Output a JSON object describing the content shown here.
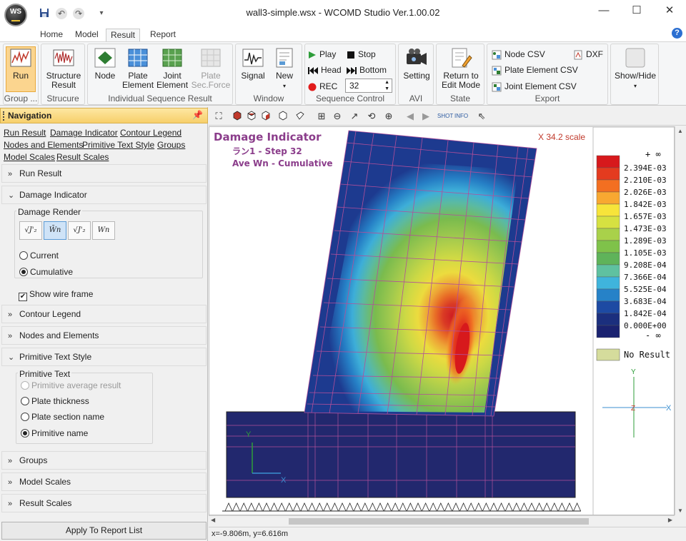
{
  "app": {
    "logo_text": "WS",
    "window_title": "wall3-simple.wsx - WCOMD Studio Ver.1.00.02",
    "tabs": [
      "Home",
      "Model",
      "Result",
      "Report"
    ],
    "active_tab": "Result"
  },
  "ribbon": {
    "group_label": "Group ...",
    "run_label": "Run",
    "structure_label": "Structure Result",
    "structure_group": "Strucure",
    "node_label": "Node",
    "plate_element_label": "Plate Element",
    "joint_element_label": "Joint Element",
    "plate_force_label": "Plate Sec.Force",
    "isr_group": "Individual Sequence Result",
    "signal_label": "Signal",
    "new_label": "New",
    "window_group": "Window",
    "play_label": "Play",
    "stop_label": "Stop",
    "head_label": "Head",
    "bottom_label": "Bottom",
    "rec_label": "REC",
    "step_value": "32",
    "sequence_group": "Sequence Control",
    "setting_label": "Setting",
    "avi_group": "AVI",
    "return_label": "Return to Edit Mode",
    "state_group": "State",
    "node_csv": "Node CSV",
    "dxf": "DXF",
    "plate_csv": "Plate Element CSV",
    "joint_csv": "Joint Element CSV",
    "export_group": "Export",
    "showhide_label": "Show/Hide"
  },
  "navigation": {
    "title": "Navigation",
    "links": [
      "Run Result",
      "Damage Indicator",
      "Contour Legend",
      "Nodes and Elements",
      "Primitive Text Style",
      "Groups",
      "Model Scales",
      "Result Scales"
    ],
    "sections": {
      "run_result": "Run Result",
      "damage_indicator": "Damage Indicator",
      "contour_legend": "Contour Legend",
      "nodes_elements": "Nodes and Elements",
      "primitive_text_style": "Primitive Text Style",
      "groups": "Groups",
      "model_scales": "Model Scales",
      "result_scales": "Result Scales"
    },
    "damage_render": {
      "title": "Damage Render",
      "buttons": [
        "√J'₂",
        "W̄n",
        "√J'₂",
        "Wn"
      ],
      "active_index": 1,
      "options": [
        "Current",
        "Cumulative"
      ],
      "selected": "Cumulative"
    },
    "show_wire_frame": "Show wire frame",
    "primitive_text": {
      "title": "Primitive Text",
      "options": [
        "Primitive average result",
        "Plate thickness",
        "Plate section name",
        "Primitive name"
      ],
      "selected": "Primitive name",
      "disabled": "Primitive average result"
    },
    "apply_button": "Apply To Report List"
  },
  "viewer": {
    "title": "Damage Indicator",
    "step_line": "ラン1 - Step 32",
    "mode_line": "Ave Wn - Cumulative",
    "scale_text": "X 34.2 scale",
    "axis_x": "X",
    "axis_y": "Y",
    "axis_z": "Z",
    "status": "x=-9.806m, y=6.616m",
    "legend": {
      "top": "+ ∞",
      "bottom": "- ∞",
      "no_result": "No Result",
      "entries": [
        {
          "label": "2.394E-03",
          "color": "#d7191c"
        },
        {
          "label": "2.210E-03",
          "color": "#e43b1f"
        },
        {
          "label": "2.026E-03",
          "color": "#f36f21"
        },
        {
          "label": "1.842E-03",
          "color": "#f8a831"
        },
        {
          "label": "1.657E-03",
          "color": "#f7e43a"
        },
        {
          "label": "1.473E-03",
          "color": "#d6e141"
        },
        {
          "label": "1.289E-03",
          "color": "#a9d14a"
        },
        {
          "label": "1.105E-03",
          "color": "#7fc24a"
        },
        {
          "label": "9.208E-04",
          "color": "#5fb35a"
        },
        {
          "label": "7.366E-04",
          "color": "#5fc1a0"
        },
        {
          "label": "5.525E-04",
          "color": "#3fb4dc"
        },
        {
          "label": "3.683E-04",
          "color": "#2682c8"
        },
        {
          "label": "1.842E-04",
          "color": "#1d4aa3"
        },
        {
          "label": "0.000E+00",
          "color": "#1b2f7e"
        },
        {
          "label": "",
          "color": "#1a2270"
        }
      ],
      "no_result_color": "#d5dc9c"
    }
  }
}
